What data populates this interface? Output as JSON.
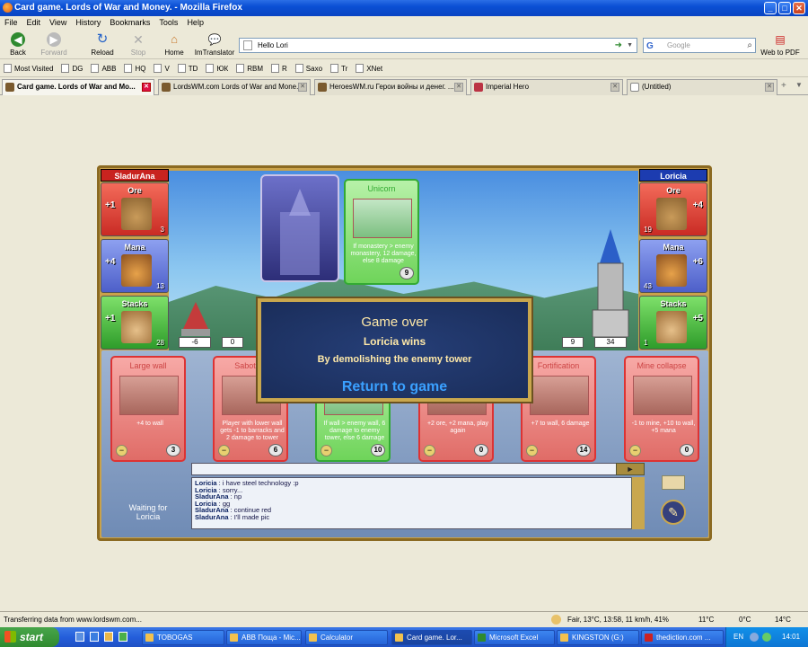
{
  "window": {
    "title": "Card game. Lords of War and Money. - Mozilla Firefox",
    "controls": [
      "_",
      "□",
      "✕"
    ]
  },
  "menu": [
    "File",
    "Edit",
    "View",
    "History",
    "Bookmarks",
    "Tools",
    "Help"
  ],
  "nav": {
    "back": "Back",
    "forward": "Forward",
    "reload": "Reload",
    "stop": "Stop",
    "home": "Home",
    "imtranslator": "ImTranslator",
    "web_to_pdf": "Web to PDF",
    "url": "Hello Lori",
    "search_placeholder": "Google"
  },
  "bookmarks": [
    "Most Visited",
    "DG",
    "ABB",
    "HQ",
    "V",
    "TD",
    "ЮК",
    "RBM",
    "R",
    "Saxo",
    "Tr",
    "XNet"
  ],
  "tabs": [
    {
      "label": "Card game. Lords of War and Mo...",
      "active": true
    },
    {
      "label": "LordsWM.com Lords of War and Mone...",
      "active": false
    },
    {
      "label": "HeroesWM.ru Герои войны и денег. ...",
      "active": false
    },
    {
      "label": "Imperial Hero",
      "active": false
    },
    {
      "label": "(Untitled)",
      "active": false
    }
  ],
  "game": {
    "player_left": {
      "name": "SladurAna",
      "resources": [
        {
          "label": "Ore",
          "increment": "+1",
          "value": "3"
        },
        {
          "label": "Mana",
          "increment": "+4",
          "value": "13"
        },
        {
          "label": "Stacks",
          "increment": "+1",
          "value": "28"
        }
      ],
      "tower": "-6",
      "wall": "0"
    },
    "player_right": {
      "name": "Loricia",
      "resources": [
        {
          "label": "Ore",
          "increment": "+4",
          "value": "19"
        },
        {
          "label": "Mana",
          "increment": "+6",
          "value": "43"
        },
        {
          "label": "Stacks",
          "increment": "+5",
          "value": "1"
        }
      ],
      "tower": "34",
      "wall": "9"
    },
    "played_card": {
      "title": "Unicorn",
      "desc": "If monastery > enemy monastery, 12 damage, else 8 damage",
      "cost": "9"
    },
    "hand": [
      {
        "title": "Large wall",
        "desc": "+4 to wall",
        "cost": "3",
        "color": "red"
      },
      {
        "title": "Sabotaje",
        "desc": "Player with lower wall gets -1 to barracks and 2 damage to tower",
        "cost": "6",
        "color": "red"
      },
      {
        "title": "",
        "desc": "If wall > enemy wall, 6 damage to enemy tower, else 6 damage",
        "cost": "10",
        "color": "green"
      },
      {
        "title": "",
        "desc": "+2 ore, +2 mana, play again",
        "cost": "0",
        "color": "red"
      },
      {
        "title": "Fortification",
        "desc": "+7 to wall, 6 damage",
        "cost": "14",
        "color": "red"
      },
      {
        "title": "Mine collapse",
        "desc": "-1 to mine, +10 to wall, +5 mana",
        "cost": "0",
        "color": "red"
      }
    ],
    "dialog": {
      "title": "Game over",
      "winner": "Loricia wins",
      "reason": "By demolishing the enemy tower",
      "return": "Return to game"
    },
    "waiting": "Waiting for Loricia",
    "chat": [
      {
        "user": "Loricia",
        "text": "i have steel technology :p"
      },
      {
        "user": "Loricia",
        "text": "sorry..."
      },
      {
        "user": "SladurAna",
        "text": "np"
      },
      {
        "user": "Loricia",
        "text": "gg"
      },
      {
        "user": "SladurAna",
        "text": "continue red"
      },
      {
        "user": "SladurAna",
        "text": "I'll made pic"
      }
    ]
  },
  "status": {
    "text": "Transferring data from www.lordswm.com...",
    "weather": "Fair, 13°C, 13:58, 11 km/h, 41%",
    "temp1": "11°C",
    "temp2": "0°C",
    "temp3": "14°C"
  },
  "taskbar": {
    "start": "start",
    "tasks": [
      "TOBOGAS",
      "ABB Поща - Mic...",
      "Calculator",
      "Card game. Lor...",
      "Microsoft Excel",
      "KINGSTON (G:)",
      "thediction.com ..."
    ],
    "lang": "EN",
    "clock": "14:01"
  }
}
